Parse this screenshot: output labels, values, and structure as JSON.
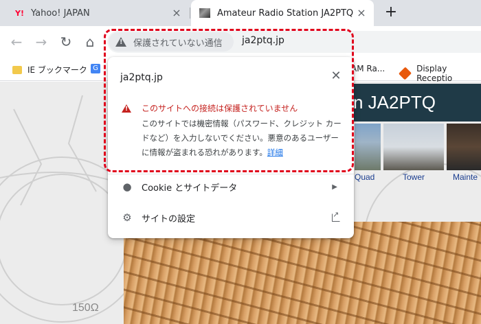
{
  "tabs": [
    {
      "title": "Yahoo! JAPAN",
      "favicon": "Y!"
    },
    {
      "title": "Amateur Radio Station JA2PTQ"
    }
  ],
  "toolbar": {
    "security_chip": "保護されていない通信",
    "url": "ja2ptq.jp"
  },
  "bookmarks": [
    {
      "label": "IE ブックマーク"
    },
    {
      "label": "AM Ra..."
    },
    {
      "label": "Display Receptio"
    }
  ],
  "page": {
    "header_title": "n JA2PTQ",
    "thumb_labels": [
      "Quad",
      "Tower",
      "Mainte"
    ],
    "ohm_text": "150Ω"
  },
  "popup": {
    "site": "ja2ptq.jp",
    "warning_heading": "このサイトへの接続は保護されていません",
    "warning_body": "このサイトでは機密情報（パスワード、クレジット カードなど）を入力しないでください。悪意のあるユーザーに情報が盗まれる恐れがあります。",
    "details_link": "詳細",
    "cookie_label": "Cookie とサイトデータ",
    "settings_label": "サイトの設定"
  },
  "colors": {
    "warning_red": "#c5221f",
    "highlight_red": "#e0001b",
    "link_blue": "#1a73e8",
    "header_bg": "#1f3a47"
  }
}
